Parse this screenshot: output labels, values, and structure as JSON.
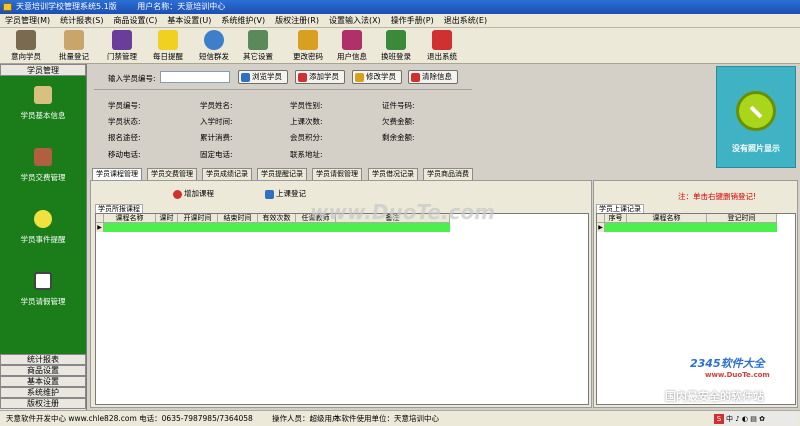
{
  "window": {
    "title": "天意培训学校管理系统5.1版",
    "unit_label": "用户名称：天意培训中心"
  },
  "menu": [
    "学员管理(M)",
    "统计报表(S)",
    "商品设置(C)",
    "基本设置(U)",
    "系统维护(V)",
    "版权注册(R)",
    "设置输入法(X)",
    "操作手册(P)",
    "退出系统(E)"
  ],
  "toolbar": [
    "意向学员",
    "批量登记",
    "门禁管理",
    "每日提醒",
    "短信群发",
    "其它设置",
    "更改密码",
    "用户信息",
    "换班登录",
    "退出系统"
  ],
  "sidebar": {
    "header": "学员管理",
    "items": [
      "学员基本信息",
      "学员交费管理",
      "学员事件提醒",
      "学员请假管理"
    ],
    "bottom": [
      "统计报表",
      "商品设置",
      "基本设置",
      "系统维护",
      "版权注册"
    ]
  },
  "search": {
    "label": "输入学员编号:",
    "value": ""
  },
  "buttons": [
    "浏览学员",
    "添加学员",
    "修改学员",
    "清除信息"
  ],
  "fields": [
    [
      "学员编号:",
      "学员姓名:",
      "学员性别:",
      "证件号码:"
    ],
    [
      "学员状态:",
      "入学时间:",
      "上课次数:",
      "欠费金额:"
    ],
    [
      "报名途径:",
      "累计消费:",
      "会员积分:",
      "剩余金额:"
    ],
    [
      "移动电话:",
      "固定电话:",
      "联系地址:",
      ""
    ]
  ],
  "photo_text": "没有照片显示",
  "tabs": [
    "学员课程管理",
    "学员交费管理",
    "学员成绩记录",
    "学员提醒记录",
    "学员请假管理",
    "学员借况记录",
    "学员商品消费"
  ],
  "course": {
    "add_label": "增加课程",
    "attend_label": "上课登记",
    "subtab": "学员所报课程",
    "columns": [
      "课程名称",
      "课时",
      "开课时间",
      "结束时间",
      "有效次数",
      "任课教师",
      "备注"
    ]
  },
  "attend": {
    "note": "注：单击右键删销登记!",
    "subtab": "学员上课记录",
    "columns": [
      "序号",
      "课程名称",
      "登记时间"
    ]
  },
  "status": {
    "developer": "天意软件开发中心 www.chle828.com 电话：0635-7987985/7364058",
    "operator": "操作人员：超级用户",
    "unit": "本软件使用单位：天意培训中心"
  },
  "watermarks": {
    "center": "www.DuoTe.com",
    "logo": "2345软件大全",
    "logo_url": "www.DuoTe.com",
    "footer": "国内最安全的软件站"
  },
  "tray": "中 ♪ ◐ ▤ ✿",
  "colors": {
    "green": "#1a7d1a",
    "row_highlight": "#4bf04b",
    "titlebar": "#2b6fd6",
    "note_red": "#d40000"
  }
}
